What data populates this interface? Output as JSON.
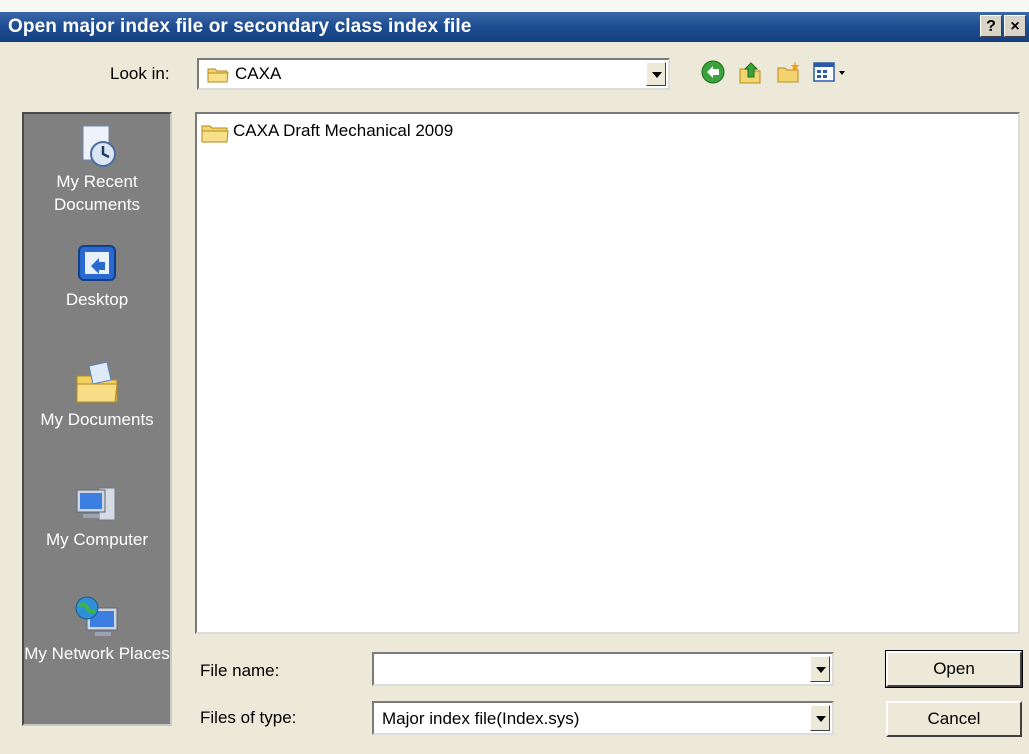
{
  "window": {
    "title": "Open major index file or secondary class index file",
    "help_label": "?",
    "close_label": "×"
  },
  "lookin": {
    "label": "Look in:",
    "value": "CAXA"
  },
  "toolbar": {
    "icons": [
      "back-icon",
      "up-folder-icon",
      "new-folder-icon",
      "views-menu-icon"
    ]
  },
  "places": [
    {
      "label": "My Recent Documents",
      "icon": "recent-documents-icon"
    },
    {
      "label": "Desktop",
      "icon": "desktop-icon"
    },
    {
      "label": "My Documents",
      "icon": "my-documents-icon"
    },
    {
      "label": "My Computer",
      "icon": "my-computer-icon"
    },
    {
      "label": "My Network Places",
      "icon": "network-places-icon"
    }
  ],
  "files": [
    {
      "name": "CAXA Draft Mechanical 2009",
      "icon": "folder-icon"
    }
  ],
  "form": {
    "filename_label": "File name:",
    "filename_value": "",
    "filetype_label": "Files of type:",
    "filetype_value": "Major index file(Index.sys)"
  },
  "buttons": {
    "open": "Open",
    "cancel": "Cancel"
  },
  "colors": {
    "titlebar": "#1f4e93",
    "dialog_bg": "#ece9d8",
    "places_bg": "#808080"
  }
}
